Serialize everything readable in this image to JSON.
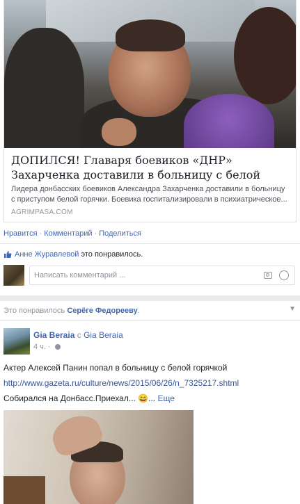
{
  "link_preview": {
    "title": "ДОПИЛСЯ! Главаря боевиков «ДНР» Захарченка доставили в больницу с белой горячкой! | Онлайн...",
    "description": "Лидера донбасских боевиков Александра Захарченка доставили в больницу с приступом белой горячки. Боевика госпитализировали в психиатрическое...",
    "domain": "AGRIMPASA.COM"
  },
  "actions": {
    "like": "Нравится",
    "comment": "Комментарий",
    "share": "Поделиться",
    "separator": "·"
  },
  "likes": {
    "name": "Анне Журавлевой",
    "rest": "это понравилось."
  },
  "comment_box": {
    "placeholder": "Написать комментарий ..."
  },
  "story": {
    "prefix": "Это понравилось",
    "name": "Серёге Федорееву",
    "suffix": "."
  },
  "post": {
    "author": "Gia Beraia",
    "with_word": "с",
    "with_name": "Gia Beraia",
    "time": "4 ч.",
    "dot": "·",
    "line1": "Актер Алексей Панин попал в больницу с белой горячкой",
    "link": "http://www.gazeta.ru/culture/news/2015/06/26/n_7325217.shtml",
    "line3": "Собирался на Донбасс.Приехал... 😄...",
    "more": "Еще"
  },
  "icons": [
    "thumbs-up-icon",
    "camera-icon",
    "smiley-icon",
    "chevron-down-icon",
    "globe-icon"
  ]
}
